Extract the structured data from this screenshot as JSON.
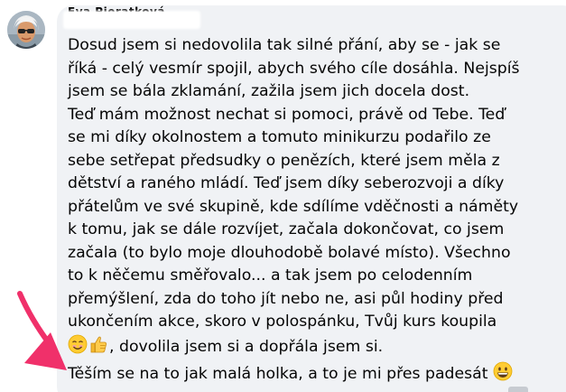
{
  "comment": {
    "author_name": "Eva Pieratková",
    "avatar_icon": "user-avatar-photo",
    "lines": [
      "Dosud jsem si nedovolila tak silné přání, aby se - jak se",
      "říká - celý vesmír spojil, abych svého cíle dosáhla. Nejspíš",
      "jsem se bála zklamání, zažila jsem jich docela dost.",
      "Teď mám možnost nechat si pomoci, právě od Tebe. Teď",
      "se mi díky okolnostem a tomuto minikurzu podařilo ze",
      "sebe setřepat předsudky o penězích, které jsem měla z",
      "dětství a raného mládí. Teď jsem díky seberozvoji a díky",
      "přátelům ve své skupině, kde sdílíme vděčnosti a náměty",
      "k tomu, jak se dále rozvíjet, začala dokončovat, co jsem",
      "začala (to bylo moje dlouhodobě bolavé místo). Všechno",
      "to k něčemu směřovalo... a tak jsem po celodenním",
      "přemýšlení, zda do toho jít nebo ne, asi půl hodiny před",
      "ukončením akce, skoro v polospánku, Tvůj kurs koupila"
    ],
    "line_14_text": ", dovolila jsem si a dopřála jsem si.",
    "line_14_emojis": [
      "smiling-face-emoji",
      "thumbs-up-emoji"
    ],
    "line_15_text": "Těším se na to jak malá holka, a to je mi přes padesát",
    "line_15_emoji": "grinning-face-emoji"
  },
  "annotation": {
    "arrow_icon": "pink-arrow-icon",
    "arrow_color": "#f0306a"
  },
  "colors": {
    "bubble_background": "#f0f2f5",
    "text": "#050505"
  }
}
